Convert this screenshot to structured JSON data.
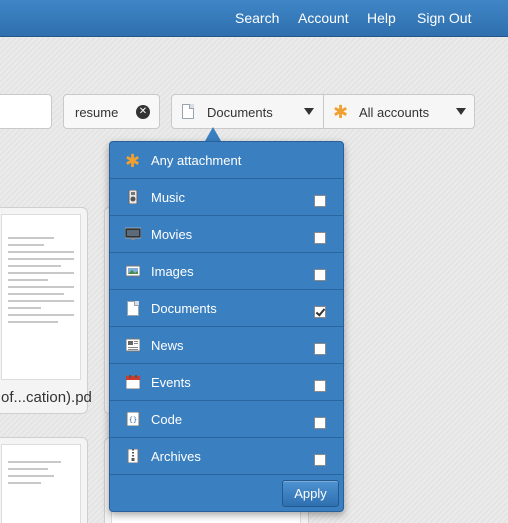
{
  "nav": {
    "search": "Search",
    "account": "Account",
    "help": "Help",
    "signout": "Sign Out"
  },
  "search": {
    "token": "resume"
  },
  "filters": {
    "type_selected": "Documents",
    "account_selected": "All accounts"
  },
  "menu": {
    "items": [
      {
        "label": "Any attachment",
        "icon": "asterisk-icon",
        "checked": null
      },
      {
        "label": "Music",
        "icon": "music-icon",
        "checked": false
      },
      {
        "label": "Movies",
        "icon": "movie-icon",
        "checked": false
      },
      {
        "label": "Images",
        "icon": "image-icon",
        "checked": false
      },
      {
        "label": "Documents",
        "icon": "document-icon",
        "checked": true
      },
      {
        "label": "News",
        "icon": "news-icon",
        "checked": false
      },
      {
        "label": "Events",
        "icon": "calendar-icon",
        "checked": false
      },
      {
        "label": "Code",
        "icon": "code-icon",
        "checked": false
      },
      {
        "label": "Archives",
        "icon": "archive-icon",
        "checked": false
      }
    ],
    "apply_label": "Apply"
  },
  "results": {
    "card1_caption": "of...cation).pd"
  },
  "colors": {
    "topbar": "#3a7fc0",
    "menu": "#3a7fc0",
    "accent_orange": "#f0a030"
  }
}
